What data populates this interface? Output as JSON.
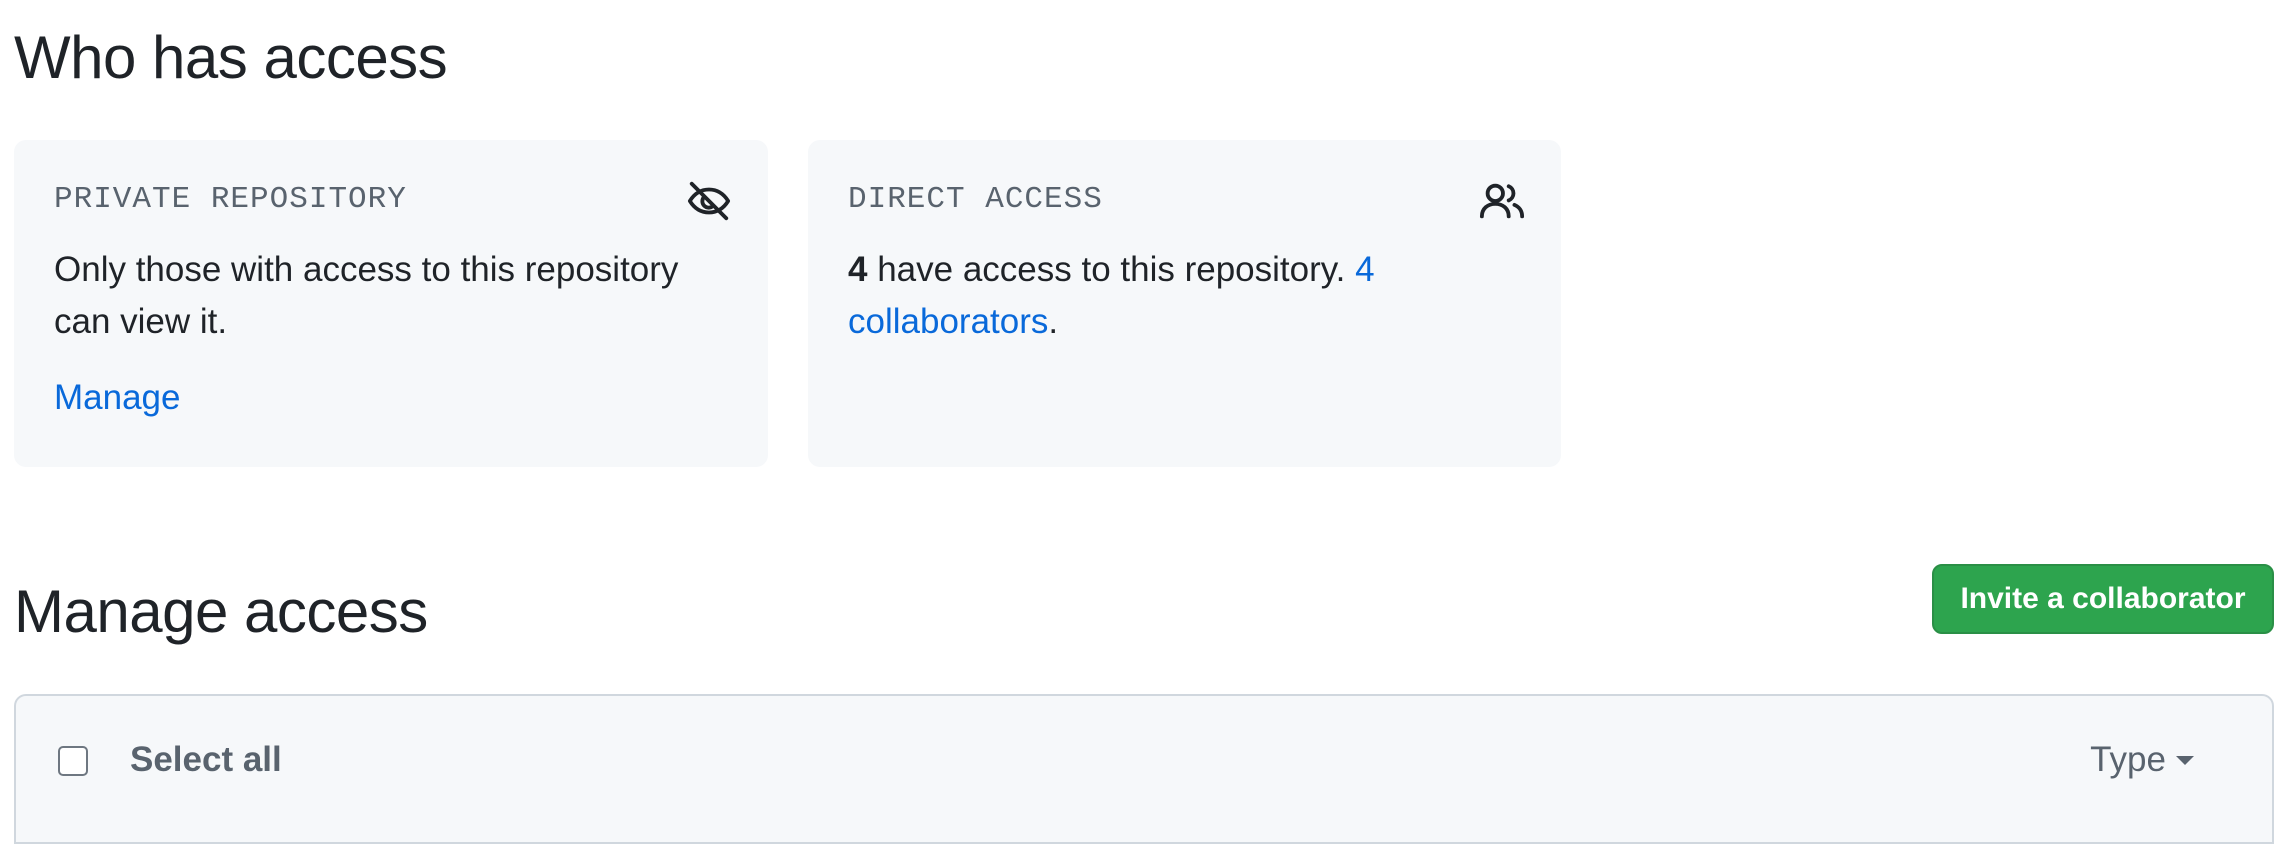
{
  "who_has_access": {
    "title": "Who has access",
    "private_card": {
      "label": "PRIVATE REPOSITORY",
      "icon": "eye-closed-icon",
      "text": "Only those with access to this repository can view it.",
      "manage_link": "Manage"
    },
    "direct_card": {
      "label": "DIRECT ACCESS",
      "icon": "people-icon",
      "count": "4",
      "text_middle": " have access to this repository. ",
      "collaborators_link": "4 collaborators",
      "text_end": "."
    }
  },
  "manage_access": {
    "title": "Manage access",
    "invite_button": "Invite a collaborator",
    "table_header": {
      "select_all_label": "Select all",
      "type_filter_label": "Type"
    }
  },
  "colors": {
    "accent_green": "#2da44e",
    "link_blue": "#0969da",
    "card_bg": "#f6f8fa"
  }
}
